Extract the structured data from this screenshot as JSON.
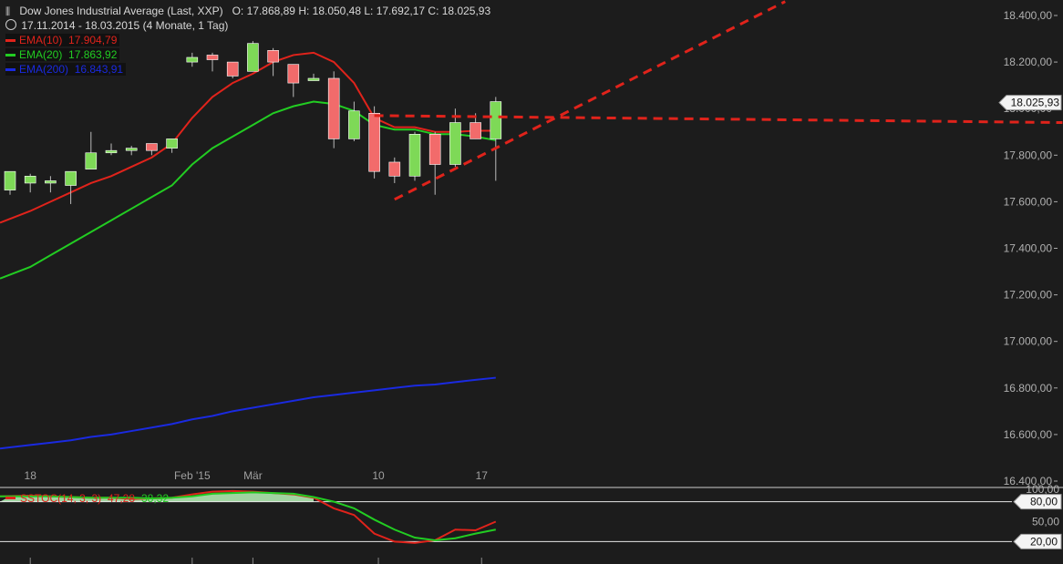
{
  "header": {
    "title": "Dow Jones Industrial Average (Last, XXP)",
    "ohlc": "O: 17.868,89  H: 18.050,48  L: 17.692,17  C: 18.025,93",
    "period": "17.11.2014 - 18.03.2015 (4 Monate, 1 Tag)"
  },
  "legend": [
    {
      "label": "EMA(10)",
      "value": "17.904,79",
      "color": "#e0231b"
    },
    {
      "label": "EMA(20)",
      "value": "17.863,92",
      "color": "#22cc22"
    },
    {
      "label": "EMA(200)",
      "value": "16.843,91",
      "color": "#1a2ae0"
    }
  ],
  "chart_data": [
    {
      "type": "candlestick",
      "title": "Dow Jones Industrial Average (Last, XXP)",
      "x_tick_labels": [
        "18",
        "Feb '15",
        "Mär",
        "10",
        "17"
      ],
      "y_tick_labels": [
        "18.400,00",
        "18.200,00",
        "18.000,00",
        "17.800,00",
        "17.600,00",
        "17.400,00",
        "17.200,00",
        "17.000,00",
        "16.800,00",
        "16.600,00",
        "16.400,00"
      ],
      "ylim": [
        16400,
        18450
      ],
      "last_price_label": "18.025,93",
      "candles": [
        {
          "o": 17650,
          "h": 17680,
          "l": 17630,
          "c": 17730
        },
        {
          "o": 17680,
          "h": 17720,
          "l": 17640,
          "c": 17710
        },
        {
          "o": 17680,
          "h": 17710,
          "l": 17640,
          "c": 17690
        },
        {
          "o": 17670,
          "h": 17720,
          "l": 17590,
          "c": 17730
        },
        {
          "o": 17740,
          "h": 17900,
          "l": 17740,
          "c": 17810
        },
        {
          "o": 17810,
          "h": 17850,
          "l": 17800,
          "c": 17820
        },
        {
          "o": 17820,
          "h": 17840,
          "l": 17800,
          "c": 17830
        },
        {
          "o": 17850,
          "h": 17850,
          "l": 17800,
          "c": 17820
        },
        {
          "o": 17830,
          "h": 17870,
          "l": 17810,
          "c": 17870
        },
        {
          "o": 18200,
          "h": 18240,
          "l": 18180,
          "c": 18220
        },
        {
          "o": 18230,
          "h": 18240,
          "l": 18160,
          "c": 18210
        },
        {
          "o": 18200,
          "h": 18200,
          "l": 18130,
          "c": 18140
        },
        {
          "o": 18160,
          "h": 18290,
          "l": 18160,
          "c": 18280
        },
        {
          "o": 18250,
          "h": 18260,
          "l": 18140,
          "c": 18200
        },
        {
          "o": 18190,
          "h": 18190,
          "l": 18050,
          "c": 18110
        },
        {
          "o": 18120,
          "h": 18150,
          "l": 18120,
          "c": 18130
        },
        {
          "o": 18130,
          "h": 18160,
          "l": 17830,
          "c": 17870
        },
        {
          "o": 17870,
          "h": 18030,
          "l": 17860,
          "c": 17990
        },
        {
          "o": 17980,
          "h": 18010,
          "l": 17700,
          "c": 17730
        },
        {
          "o": 17770,
          "h": 17790,
          "l": 17680,
          "c": 17710
        },
        {
          "o": 17710,
          "h": 17900,
          "l": 17690,
          "c": 17890
        },
        {
          "o": 17890,
          "h": 17900,
          "l": 17630,
          "c": 17760
        },
        {
          "o": 17760,
          "h": 18000,
          "l": 17750,
          "c": 17940
        },
        {
          "o": 17940,
          "h": 17980,
          "l": 17870,
          "c": 17870
        },
        {
          "o": 17870,
          "h": 18050,
          "l": 17690,
          "c": 18030
        }
      ],
      "series": [
        {
          "name": "EMA(10)",
          "color": "#e0231b",
          "values": [
            17510,
            17560,
            17600,
            17640,
            17680,
            17710,
            17750,
            17790,
            17850,
            17960,
            18050,
            18110,
            18150,
            18200,
            18230,
            18240,
            18200,
            18110,
            17960,
            17920,
            17920,
            17900,
            17900,
            17905,
            17905
          ]
        },
        {
          "name": "EMA(20)",
          "color": "#22cc22",
          "values": [
            17270,
            17320,
            17370,
            17420,
            17470,
            17520,
            17570,
            17620,
            17670,
            17760,
            17830,
            17880,
            17930,
            17980,
            18010,
            18030,
            18020,
            17990,
            17930,
            17910,
            17910,
            17890,
            17890,
            17880,
            17864
          ]
        },
        {
          "name": "EMA(200)",
          "color": "#1a2ae0",
          "values": [
            16540,
            16555,
            16565,
            16575,
            16590,
            16600,
            16615,
            16630,
            16645,
            16665,
            16680,
            16700,
            16715,
            16730,
            16745,
            16760,
            16770,
            16780,
            16790,
            16800,
            16810,
            16815,
            16825,
            16835,
            16844
          ]
        }
      ],
      "trendlines": [
        {
          "from": {
            "x": 19,
            "y": 17610
          },
          "to": {
            "x": 38.3,
            "y": 18460
          },
          "style": "dashed",
          "color": "#e0231b"
        },
        {
          "from": {
            "x": 18,
            "y": 17970
          },
          "to": {
            "x": 52,
            "y": 17940
          },
          "style": "dashed",
          "color": "#e0231b"
        }
      ]
    },
    {
      "type": "line",
      "title": "SSTOC(14, 3, 3)",
      "legend_label": "SSTOC(14, 3, 3)",
      "legend_values": [
        "47,28",
        "38,32"
      ],
      "y_tick_labels": [
        "100,00",
        "80,00",
        "50,00",
        "20,00"
      ],
      "ylim": [
        0,
        100
      ],
      "bands": [
        80,
        20
      ],
      "series": [
        {
          "name": "%K",
          "color": "#e0231b",
          "values": [
            88,
            89,
            88,
            87,
            86,
            86,
            84,
            85,
            86,
            91,
            95,
            96,
            95,
            93,
            91,
            86,
            70,
            60,
            32,
            20,
            18,
            22,
            38,
            37,
            50
          ]
        },
        {
          "name": "%D",
          "color": "#22cc22",
          "values": [
            88,
            88,
            88,
            87,
            86,
            86,
            86,
            85,
            86,
            88,
            92,
            93,
            94,
            93,
            92,
            87,
            80,
            70,
            53,
            38,
            26,
            22,
            25,
            32,
            38
          ]
        }
      ]
    }
  ]
}
